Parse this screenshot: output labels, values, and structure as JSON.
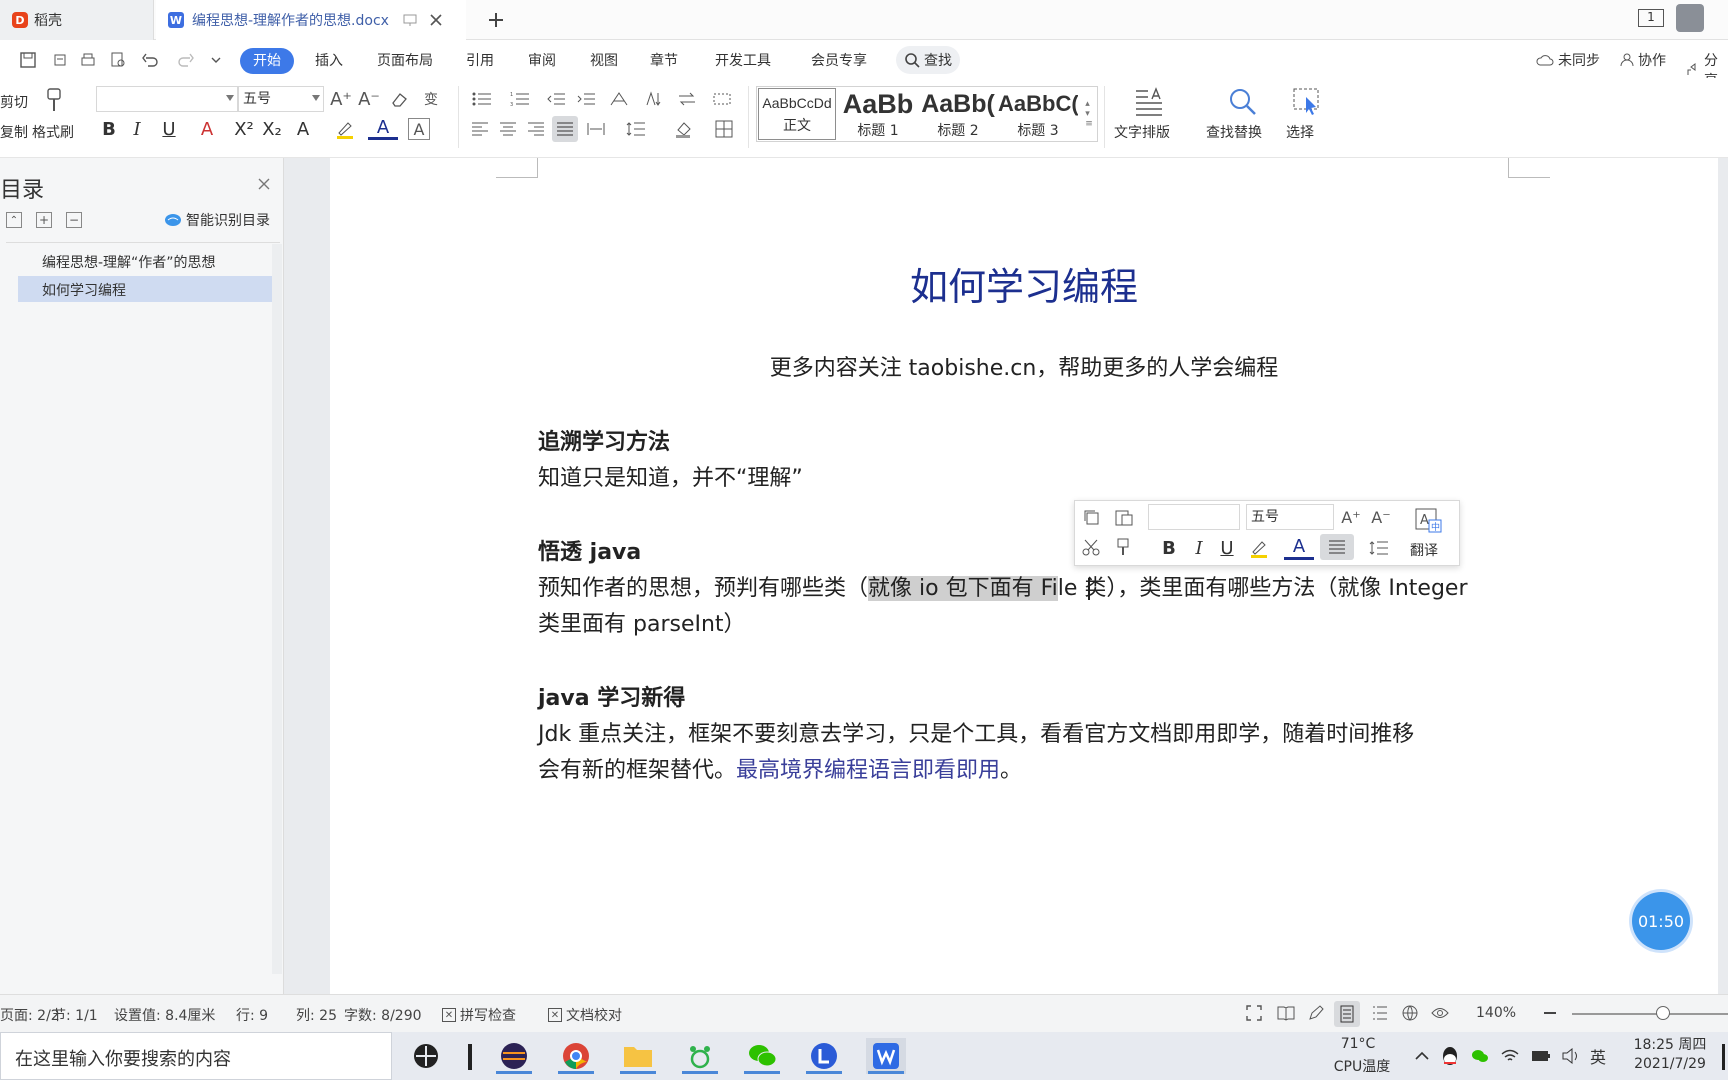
{
  "titlebar": {
    "home_tab": "稻壳",
    "doc_tab": "编程思想-理解作者的思想.docx",
    "page_badge": "1"
  },
  "menu": {
    "items": [
      "开始",
      "插入",
      "页面布局",
      "引用",
      "审阅",
      "视图",
      "章节",
      "开发工具",
      "会员专享"
    ],
    "search": "查找",
    "unsynced": "未同步",
    "collab": "协作",
    "share": "分享"
  },
  "ribbon": {
    "cut": "剪切",
    "copy": "复制",
    "format_painter": "格式刷",
    "font_name": "",
    "font_size": "五号",
    "styles": [
      {
        "preview": "AaBbCcDd",
        "label": "正文"
      },
      {
        "preview": "AaBb",
        "label": "标题 1"
      },
      {
        "preview": "AaBb(",
        "label": "标题 2"
      },
      {
        "preview": "AaBbC(",
        "label": "标题 3"
      }
    ],
    "text_layout": "文字排版",
    "find_replace": "查找替换",
    "select": "选择"
  },
  "nav": {
    "title": "目录",
    "smart_toc": "智能识别目录",
    "items": [
      "编程思想-理解“作者”的思想",
      "如何学习编程"
    ]
  },
  "doc": {
    "title": "如何学习编程",
    "subtitle": "更多内容关注 taobishe.cn，帮助更多的人学会编程",
    "h1": "追溯学习方法",
    "p1": "知道只是知道，并不“理解”",
    "h2": "悟透 java",
    "p2a_pre": "预知作者的思想，预判有哪些类（",
    "p2a_sel": "就像 io 包下面有 Fi",
    "p2a_post": "le 类），类里面有哪些方法（就像 Integer",
    "p2b": "类里面有 parseInt）",
    "h3": "java 学习新得",
    "p3a": "Jdk 重点关注，框架不要刻意去学习，只是个工具，看看官方文档即用即学，随着时间推移",
    "p3b_pre": "会有新的框架替代。",
    "p3b_link": "最高境界编程语言即看即用",
    "p3b_post": "。"
  },
  "minitoolbar": {
    "font_name": "",
    "font_size": "五号",
    "translate": "翻译"
  },
  "timer": "01:50",
  "status": {
    "page": "页面: 2/2",
    "section": "节: 1/1",
    "setting": "设置值: 8.4厘米",
    "row": "行: 9",
    "col": "列: 25",
    "words": "字数: 8/290",
    "spell": "拼写检查",
    "proof": "文档校对",
    "zoom": "140%"
  },
  "taskbar": {
    "search_placeholder": "在这里输入你要搜索的内容",
    "temp": "71°C",
    "temp_label": "CPU温度",
    "ime": "英",
    "time": "18:25 周四",
    "date": "2021/7/29"
  },
  "colors": {
    "accent": "#3d79e8",
    "title_blue": "#1c2f8f",
    "link_blue": "#3a3f9a"
  }
}
